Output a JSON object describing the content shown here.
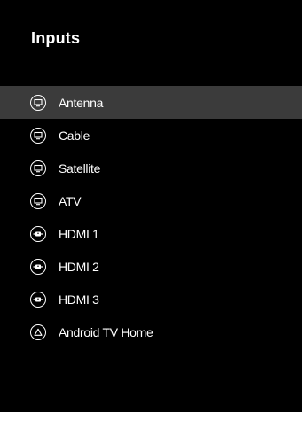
{
  "title": "Inputs",
  "items": [
    {
      "label": "Antenna",
      "icon": "tv-icon",
      "selected": true
    },
    {
      "label": "Cable",
      "icon": "tv-icon",
      "selected": false
    },
    {
      "label": "Satellite",
      "icon": "tv-icon",
      "selected": false
    },
    {
      "label": "ATV",
      "icon": "tv-icon",
      "selected": false
    },
    {
      "label": "HDMI 1",
      "icon": "hdmi-icon",
      "selected": false
    },
    {
      "label": "HDMI 2",
      "icon": "hdmi-icon",
      "selected": false
    },
    {
      "label": "HDMI 3",
      "icon": "hdmi-icon",
      "selected": false
    },
    {
      "label": "Android TV Home",
      "icon": "home-icon",
      "selected": false
    }
  ],
  "colors": {
    "background": "#000000",
    "selected_row": "#3b3b3b",
    "text": "#ffffff"
  }
}
